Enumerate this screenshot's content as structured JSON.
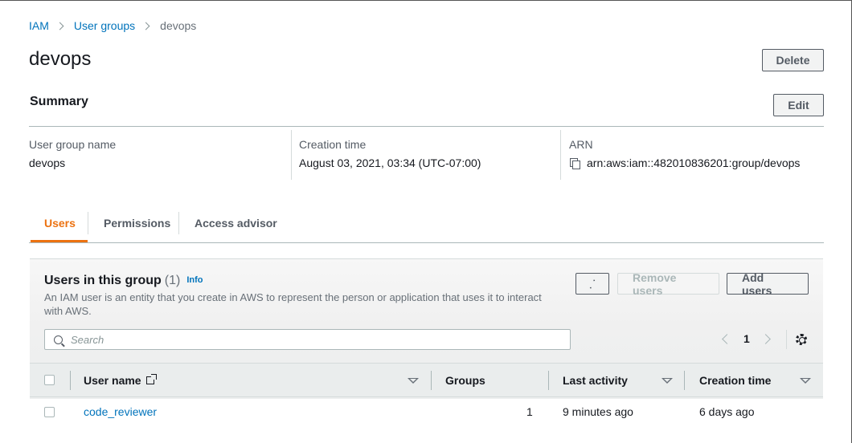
{
  "breadcrumb": {
    "root": "IAM",
    "section": "User groups",
    "current": "devops"
  },
  "page": {
    "title": "devops",
    "delete_label": "Delete"
  },
  "summary": {
    "title": "Summary",
    "edit_label": "Edit",
    "fields": [
      {
        "label": "User group name",
        "value": "devops"
      },
      {
        "label": "Creation time",
        "value": "August 03, 2021, 03:34 (UTC-07:00)"
      },
      {
        "label": "ARN",
        "value": "arn:aws:iam::482010836201:group/devops"
      }
    ]
  },
  "tabs": [
    {
      "label": "Users",
      "active": true
    },
    {
      "label": "Permissions",
      "active": false
    },
    {
      "label": "Access advisor",
      "active": false
    }
  ],
  "users_panel": {
    "title": "Users in this group",
    "count": "(1)",
    "info_label": "Info",
    "description": "An IAM user is an entity that you create in AWS to represent the person or application that uses it to interact with AWS.",
    "refresh_icon": "refresh-icon",
    "remove_label": "Remove users",
    "add_label": "Add users",
    "search_placeholder": "Search",
    "page_number": "1",
    "columns": [
      "User name",
      "Groups",
      "Last activity",
      "Creation time"
    ],
    "rows": [
      {
        "user_name": "code_reviewer",
        "groups": "1",
        "last_activity": "9 minutes ago",
        "creation_time": "6 days ago"
      }
    ]
  },
  "colors": {
    "link": "#0073bb",
    "active_tab": "#ec7211",
    "text": "#16191f",
    "muted": "#687078"
  }
}
